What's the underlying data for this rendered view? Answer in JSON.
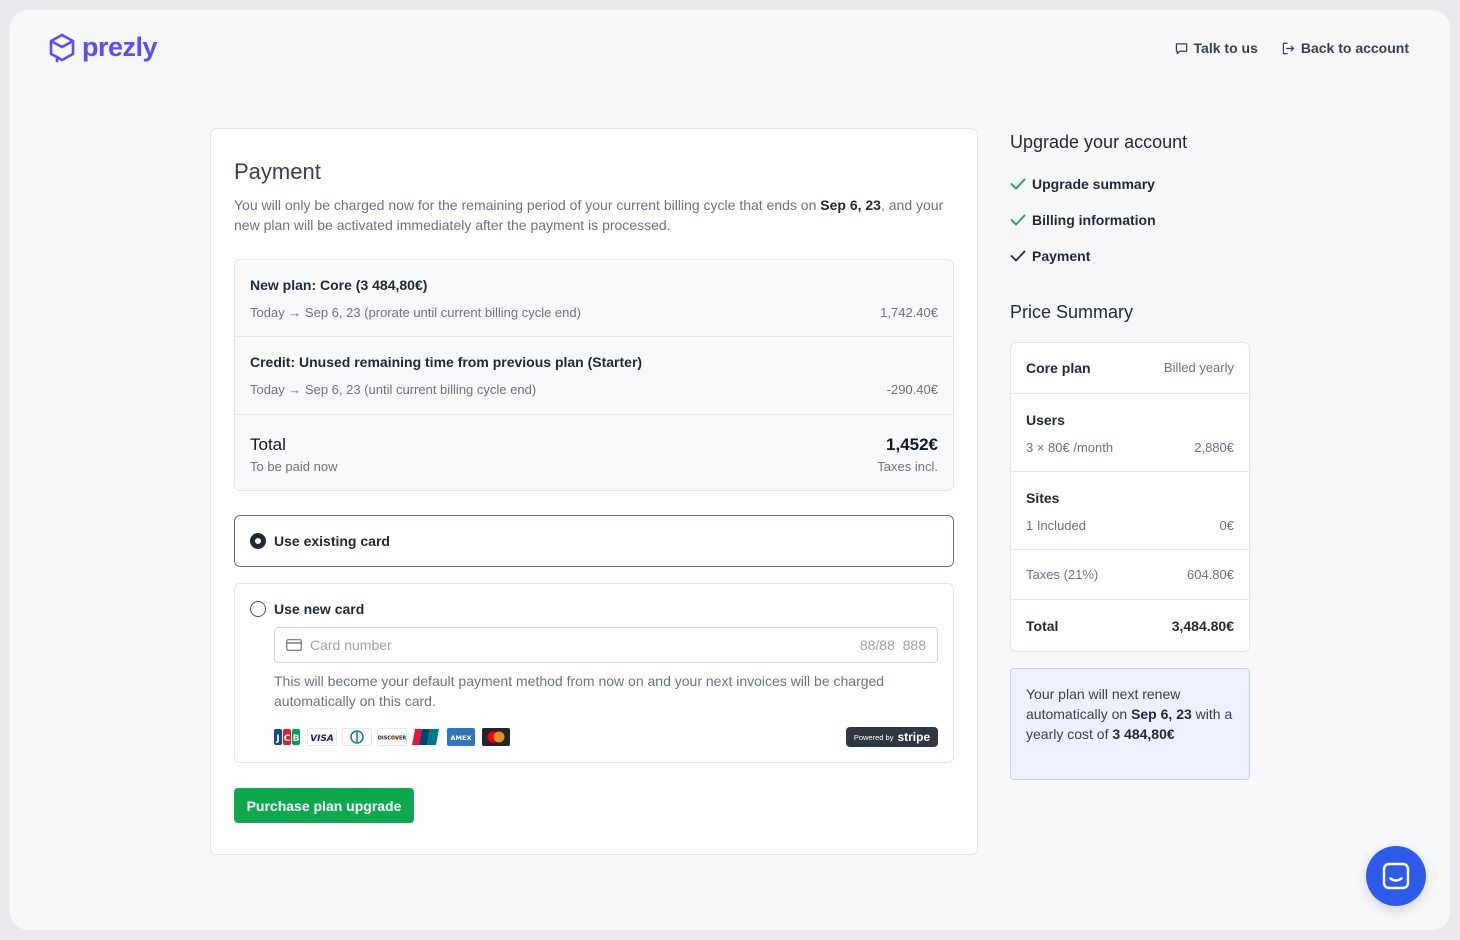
{
  "brand": {
    "name": "prezly",
    "color": "#5b4ef5"
  },
  "topnav": {
    "talk": "Talk to us",
    "back": "Back to account"
  },
  "payment": {
    "title": "Payment",
    "intro_before": "You will only be charged now for the remaining period of your current billing cycle that ends on ",
    "intro_date": "Sep 6, 23",
    "intro_after": ", and your new plan will be activated immediately after the payment is processed.",
    "new_plan": {
      "title": "New plan: Core (3 484,80€)",
      "period": "Today → Sep 6, 23 (prorate until current billing cycle end)",
      "amount": "1,742.40€"
    },
    "credit": {
      "title": "Credit: Unused remaining time from previous plan (Starter)",
      "period": "Today → Sep 6, 23 (until current billing cycle end)",
      "amount": "-290.40€"
    },
    "total": {
      "label": "Total",
      "sub": "To be paid now",
      "amount": "1,452€",
      "note": "Taxes incl."
    },
    "existing_card_label": "Use existing card",
    "new_card_label": "Use new card",
    "card_placeholder": "Card number",
    "card_hint": "88/88  888",
    "new_card_note": "This will become your default payment method from now on and your next invoices will be charged automatically on this card.",
    "card_brands": [
      "JCB",
      "VISA",
      "Diners",
      "DISCOVER",
      "UnionPay",
      "AMEX",
      "Mastercard"
    ],
    "powered_by": "Powered by",
    "stripe": "stripe",
    "purchase_label": "Purchase plan upgrade"
  },
  "upgrade": {
    "title": "Upgrade your account",
    "steps": [
      "Upgrade summary",
      "Billing information",
      "Payment"
    ]
  },
  "price_summary": {
    "title": "Price Summary",
    "plan": "Core plan",
    "billing": "Billed yearly",
    "users_title": "Users",
    "users_detail": "3 × 80€ /month",
    "users_amount": "2,880€",
    "sites_title": "Sites",
    "sites_detail": "1 Included",
    "sites_amount": "0€",
    "taxes_label": "Taxes (21%)",
    "taxes_amount": "604.80€",
    "total_label": "Total",
    "total_amount": "3,484.80€"
  },
  "renew": {
    "before": "Your plan will next renew automatically on ",
    "date": "Sep 6, 23",
    "mid": " with a yearly cost of ",
    "cost": "3 484,80€"
  },
  "colors": {
    "accent_green": "#0ea84f",
    "chat_blue": "#2f5bea",
    "check_green": "#16a34a"
  }
}
